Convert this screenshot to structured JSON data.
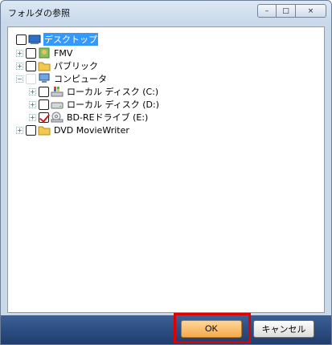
{
  "window": {
    "title": "フォルダの参照",
    "minimize_label": "–",
    "maximize_label": "□",
    "close_label": "×"
  },
  "tree": {
    "items": [
      {
        "label": "デスクトップ",
        "icon": "desktop-icon",
        "state": "unchecked",
        "selected": true
      },
      {
        "label": "FMV",
        "icon": "user-folder-icon",
        "state": "unchecked"
      },
      {
        "label": "パブリック",
        "icon": "folder-icon",
        "state": "unchecked"
      },
      {
        "label": "コンピュータ",
        "icon": "computer-icon",
        "state": "faint"
      },
      {
        "label": "ローカル ディスク (C:)",
        "icon": "windows-drive-icon",
        "state": "unchecked"
      },
      {
        "label": "ローカル ディスク (D:)",
        "icon": "drive-icon",
        "state": "unchecked"
      },
      {
        "label": "BD-REドライブ (E:)",
        "icon": "optical-drive-icon",
        "state": "checked"
      },
      {
        "label": "DVD MovieWriter",
        "icon": "folder-icon",
        "state": "unchecked"
      }
    ]
  },
  "buttons": {
    "ok_label": "OK",
    "cancel_label": "キャンセル"
  },
  "colors": {
    "selection": "#3399ff",
    "ok_button": "#f5a94a",
    "highlight_box": "#e00000",
    "checkmark": "#d21a1a"
  }
}
